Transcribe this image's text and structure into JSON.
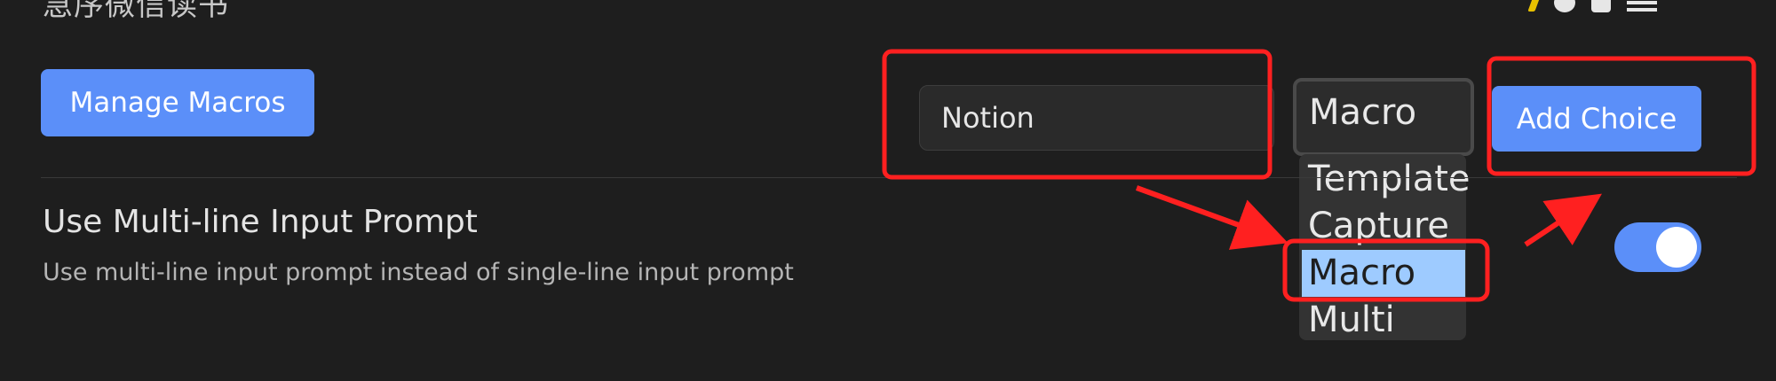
{
  "header": {
    "title_cut": "急序微信读书"
  },
  "toolbar": {
    "icons": [
      "flash-icon",
      "gear-icon",
      "clipboard-icon",
      "menu-icon"
    ]
  },
  "macros": {
    "manage_label": "Manage Macros"
  },
  "add_choice": {
    "name_value": "Notion",
    "type_selected": "Macro",
    "type_options": [
      "Template",
      "Capture",
      "Macro",
      "Multi"
    ],
    "highlighted_index": 2,
    "add_label": "Add Choice"
  },
  "settings": {
    "multiline": {
      "name": "Use Multi-line Input Prompt",
      "description": "Use multi-line input prompt instead of single-line input prompt",
      "enabled": true
    }
  },
  "colors": {
    "background": "#1e1e1e",
    "accent": "#5b8ff9",
    "highlight": "#9ecbff",
    "annotation": "#ff2020"
  }
}
